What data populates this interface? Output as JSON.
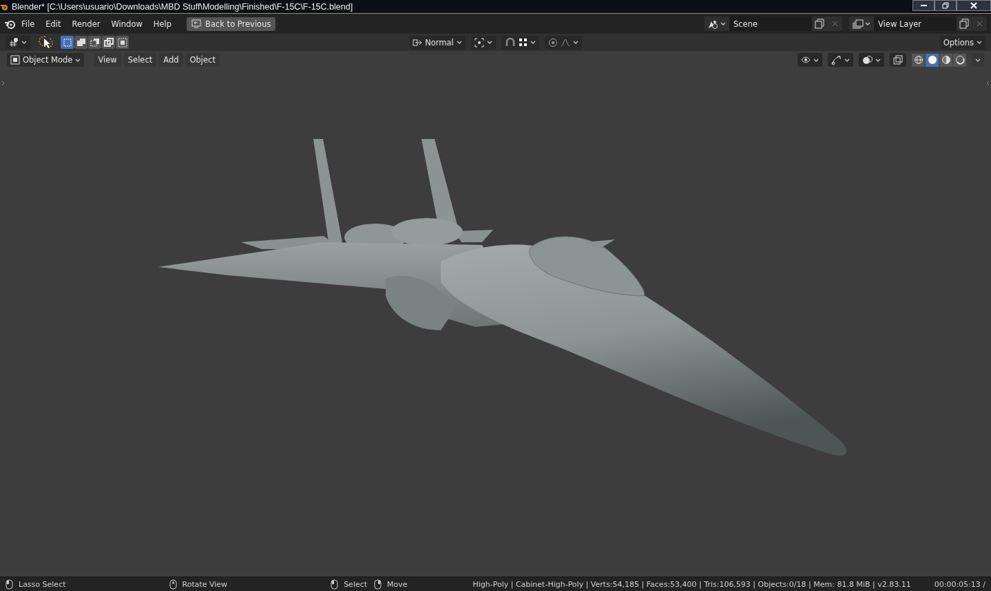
{
  "window": {
    "title": "Blender* [C:\\Users\\usuario\\Downloads\\MBD Stuff\\Modelling\\Finished\\F-15C\\F-15C.blend]"
  },
  "menu_bar": {
    "menus": [
      "File",
      "Edit",
      "Render",
      "Window",
      "Help"
    ],
    "back_button": "Back to Previous",
    "scene": "Scene",
    "view_layer": "View Layer"
  },
  "tool_header": {
    "select_modes": [
      {
        "selected": true
      },
      {
        "selected": false
      },
      {
        "selected": false
      },
      {
        "selected": false
      },
      {
        "selected": false
      }
    ],
    "orientation": "Normal",
    "options": "Options"
  },
  "viewport_header": {
    "mode": "Object Mode",
    "menus": [
      "View",
      "Select",
      "Add",
      "Object"
    ],
    "shading_modes": [
      {
        "selected": false
      },
      {
        "selected": true
      },
      {
        "selected": false
      },
      {
        "selected": false
      }
    ]
  },
  "status_bar": {
    "hints": [
      {
        "kind": "left",
        "label": "Lasso Select"
      },
      {
        "kind": "middle",
        "label": "Rotate View"
      },
      {
        "kind": "left",
        "label": "Select"
      },
      {
        "kind": "right",
        "label": "Move"
      }
    ],
    "stats": "High-Poly | Cabinet-High-Poly | Verts:54,185 | Faces:53,400 | Tris:106,593 | Objects:0/18 | Mem: 81.8 MiB | v2.83.11",
    "time": "00:00:05:13 /"
  }
}
